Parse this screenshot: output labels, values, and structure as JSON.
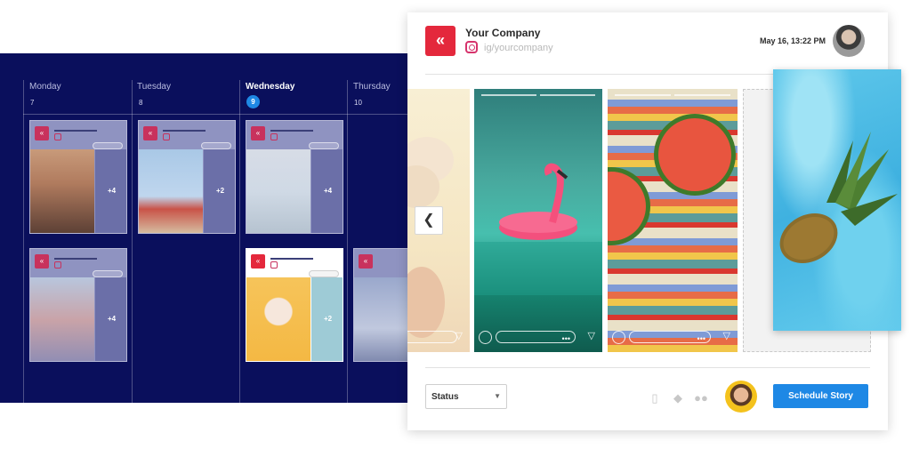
{
  "calendar": {
    "days": [
      {
        "name": "Monday",
        "num": "7"
      },
      {
        "name": "Tuesday",
        "num": "8"
      },
      {
        "name": "Wednesday",
        "num": "9"
      },
      {
        "name": "Thursday",
        "num": "10"
      }
    ],
    "cards": [
      {
        "more": "+4"
      },
      {
        "more": "+2"
      },
      {
        "more": "+4"
      },
      {
        "more": "+4"
      },
      {
        "more": "+2"
      }
    ]
  },
  "panel": {
    "company": "Your Company",
    "handle": "ig/yourcompany",
    "datetime": "May 16, 13:22 PM",
    "status_label": "Status",
    "schedule_label": "Schedule Story"
  },
  "icons": {
    "brand": "chevrons-left-logo",
    "nav": "chevron-left-icon",
    "tools": [
      "clipboard-icon",
      "tag-icon",
      "people-icon"
    ]
  },
  "colors": {
    "calendar_bg": "#0a0f5c",
    "brand_red": "#e4283c",
    "accent_blue": "#1e88e5"
  }
}
